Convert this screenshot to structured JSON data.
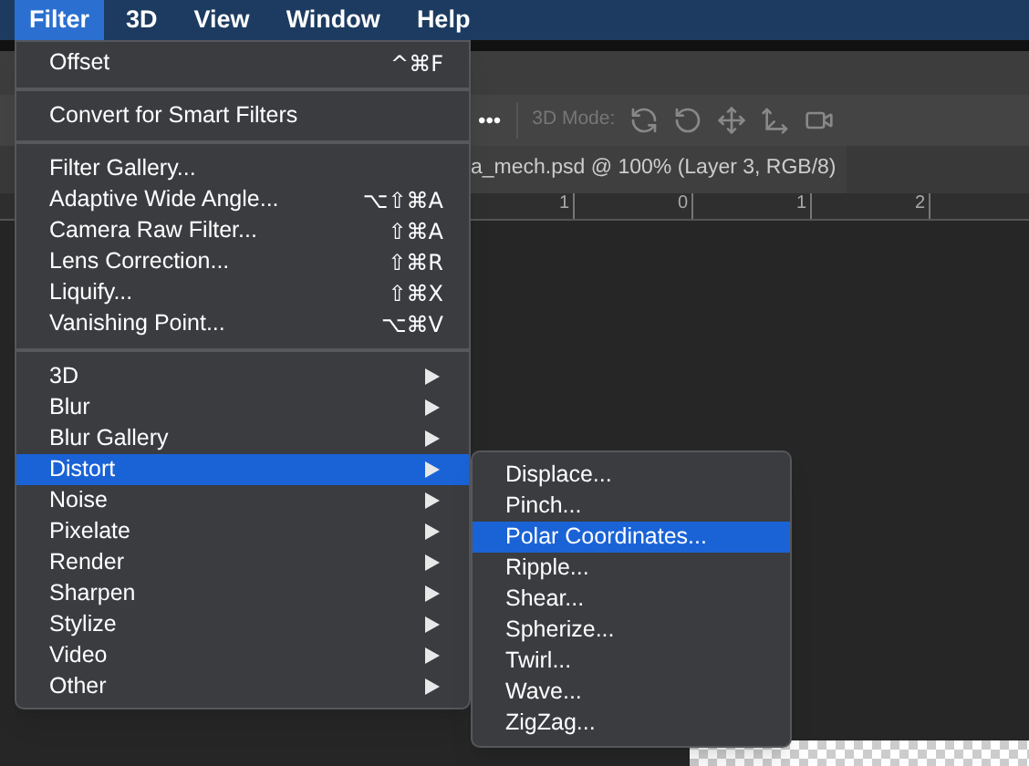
{
  "menubar": [
    {
      "label": "Filter",
      "selected": true
    },
    {
      "label": "3D",
      "selected": false
    },
    {
      "label": "View",
      "selected": false
    },
    {
      "label": "Window",
      "selected": false
    },
    {
      "label": "Help",
      "selected": false
    }
  ],
  "options_bar": {
    "more": "•••",
    "mode_label": "3D Mode:"
  },
  "document_tab": {
    "title": "a_mech.psd @ 100% (Layer 3, RGB/8)"
  },
  "ruler": {
    "labels": [
      "1",
      "0",
      "1",
      "2"
    ]
  },
  "menu": {
    "sections": [
      [
        {
          "label": "Offset",
          "shortcut": "^⌘F",
          "has_submenu": false,
          "selected": false
        }
      ],
      [
        {
          "label": "Convert for Smart Filters",
          "has_submenu": false,
          "selected": false
        }
      ],
      [
        {
          "label": "Filter Gallery...",
          "has_submenu": false,
          "selected": false
        },
        {
          "label": "Adaptive Wide Angle...",
          "shortcut": "⌥⇧⌘A",
          "has_submenu": false,
          "selected": false
        },
        {
          "label": "Camera Raw Filter...",
          "shortcut": "⇧⌘A",
          "has_submenu": false,
          "selected": false
        },
        {
          "label": "Lens Correction...",
          "shortcut": "⇧⌘R",
          "has_submenu": false,
          "selected": false
        },
        {
          "label": "Liquify...",
          "shortcut": "⇧⌘X",
          "has_submenu": false,
          "selected": false
        },
        {
          "label": "Vanishing Point...",
          "shortcut": "⌥⌘V",
          "has_submenu": false,
          "selected": false
        }
      ],
      [
        {
          "label": "3D",
          "has_submenu": true,
          "selected": false
        },
        {
          "label": "Blur",
          "has_submenu": true,
          "selected": false
        },
        {
          "label": "Blur Gallery",
          "has_submenu": true,
          "selected": false
        },
        {
          "label": "Distort",
          "has_submenu": true,
          "selected": true
        },
        {
          "label": "Noise",
          "has_submenu": true,
          "selected": false
        },
        {
          "label": "Pixelate",
          "has_submenu": true,
          "selected": false
        },
        {
          "label": "Render",
          "has_submenu": true,
          "selected": false
        },
        {
          "label": "Sharpen",
          "has_submenu": true,
          "selected": false
        },
        {
          "label": "Stylize",
          "has_submenu": true,
          "selected": false
        },
        {
          "label": "Video",
          "has_submenu": true,
          "selected": false
        },
        {
          "label": "Other",
          "has_submenu": true,
          "selected": false
        }
      ]
    ]
  },
  "submenu": {
    "items": [
      {
        "label": "Displace...",
        "selected": false
      },
      {
        "label": "Pinch...",
        "selected": false
      },
      {
        "label": "Polar Coordinates...",
        "selected": true
      },
      {
        "label": "Ripple...",
        "selected": false
      },
      {
        "label": "Shear...",
        "selected": false
      },
      {
        "label": "Spherize...",
        "selected": false
      },
      {
        "label": "Twirl...",
        "selected": false
      },
      {
        "label": "Wave...",
        "selected": false
      },
      {
        "label": "ZigZag...",
        "selected": false
      }
    ]
  }
}
